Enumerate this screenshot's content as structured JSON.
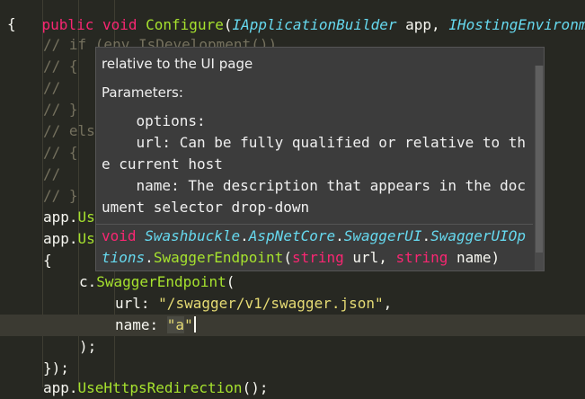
{
  "code": {
    "l0_a": "public",
    "l0_b": "void",
    "l0_c": "Configure",
    "l0_d": "IApplicationBuilder",
    "l0_e": "app,",
    "l0_f": "IHostingEnvironmen",
    "l1": "{",
    "c2": "// if (env.IsDevelopment())",
    "c3": "// {",
    "c4": "//",
    "c5": "// }",
    "c6": "// else",
    "c7": "// {",
    "c8": "//",
    "c9": "// }",
    "l10_a": "app.",
    "l10_b": "Us",
    "l11_a": "app.",
    "l11_b": "Us",
    "l12": "{",
    "l13_a": "c.",
    "l13_b": "SwaggerEndpoint",
    "l13_c": "(",
    "l14_a": "url: ",
    "l14_b": "\"/swagger/v1/swagger.json\"",
    "l14_c": ",",
    "l15_a": "name: ",
    "l15_b": "\"a",
    "l15_c": "\"",
    "l16": ");",
    "l17": "});",
    "l18_a": "app.",
    "l18_b": "UseHttpsRedirection",
    "l18_c": "();"
  },
  "popup": {
    "line1": "relative to the UI page",
    "params_title": "Parameters:",
    "p1": "    options:",
    "p2": "    url: Can be fully qualified or relative to th",
    "p3": "e current host",
    "p4": "    name: The description that appears in the doc",
    "p5": "ument selector drop-down",
    "sig": {
      "kw_void": "void",
      "ns1": "Swashbuckle",
      "ns2": "AspNetCore",
      "ns3": "SwaggerUI",
      "ns4a": "SwaggerUIOp",
      "ns4b": "tions",
      "method": "SwaggerEndpoint",
      "type1": "string",
      "arg1": " url, ",
      "type2": "string",
      "arg2": " name)"
    }
  }
}
